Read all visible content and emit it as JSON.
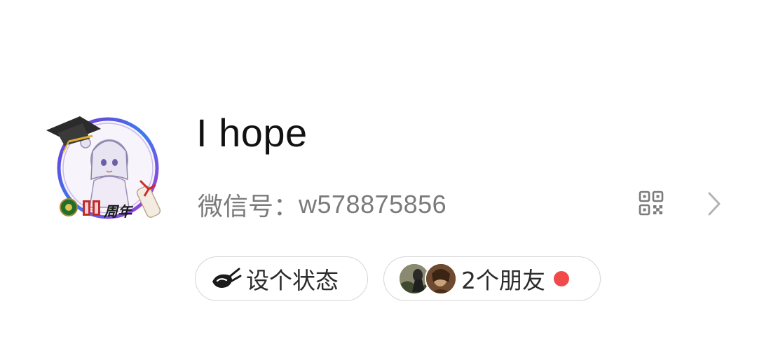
{
  "profile": {
    "name": "I hope",
    "wechat_id_label": "微信号：",
    "wechat_id_value": "w578875856",
    "avatar_badge_text": "周年"
  },
  "actions": {
    "status_label": "设个状态",
    "friends_label": "2个朋友",
    "friends_notification": true
  },
  "colors": {
    "notification_dot": "#f24a4a",
    "id_text": "#7a7a7a",
    "pill_border": "#d6d6d6"
  },
  "icons": {
    "qr": "qr-code-icon",
    "chevron": "chevron-right-icon",
    "status": "status-brush-icon"
  }
}
